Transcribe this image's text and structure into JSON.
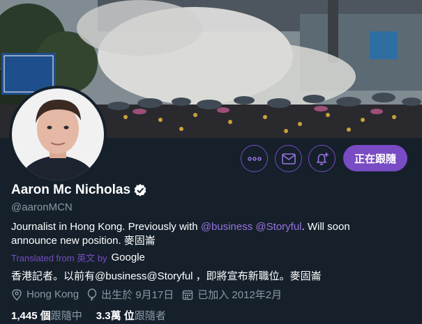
{
  "banner": {
    "alt_scene": "protest crowd with umbrellas and tear gas"
  },
  "profile": {
    "name": "Aaron Mc Nicholas",
    "handle": "@aaronMCN",
    "bio_text_1": "Journalist in Hong Kong. Previously with ",
    "bio_mention_1": "@business",
    "bio_mention_2": "@Storyful",
    "bio_text_2": ". Will soon announce new position. 麥固崙",
    "translated_label": "Translated from 英文 by",
    "translated_provider": "Google",
    "translation": "香港記者。以前有@business@Storyful ，即將宣布新職位。麥固崙",
    "location": "Hong Kong",
    "birthday": "出生於 9月17日",
    "joined": "已加入 2012年2月",
    "following_count": "1,445 個",
    "following_label": "跟隨中",
    "followers_count": "3.3萬 位",
    "followers_label": "跟隨者"
  },
  "actions": {
    "more_icon": "more-icon",
    "message_icon": "mail-icon",
    "notify_icon": "bell-plus-icon",
    "follow_label": "正在跟隨"
  },
  "colors": {
    "accent": "#794bc4",
    "background": "#15202b",
    "muted": "#8899a6"
  }
}
